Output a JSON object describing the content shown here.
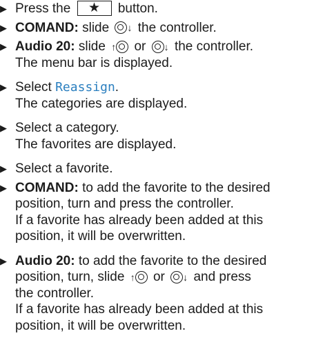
{
  "steps": [
    {
      "pre": "Press the",
      "key": "★",
      "post": "button."
    },
    {
      "label": "COMAND:",
      "text_a": "slide",
      "text_b": "the controller."
    },
    {
      "label": "Audio 20:",
      "text_a": "slide",
      "or": "or",
      "text_b": "the controller.",
      "result": "The menu bar is displayed."
    },
    {
      "pre": "Select",
      "menu_item": "Reassign",
      "post": ".",
      "result": "The categories are displayed."
    },
    {
      "text": "Select a category.",
      "result": "The favorites are displayed."
    },
    {
      "text": "Select a favorite."
    },
    {
      "label": "COMAND:",
      "text_line1": "to add the favorite to the desired",
      "text_line2": "position, turn and press the controller.",
      "result_line1": "If a favorite has already been added at this",
      "result_line2": "position, it will be overwritten."
    },
    {
      "label": "Audio 20:",
      "text_line1": "to add the favorite to the desired",
      "text_line2a": "position, turn, slide",
      "or": "or",
      "text_line2b": "and press",
      "text_line3": "the controller.",
      "result_line1": "If a favorite has already been added at this",
      "result_line2": "position, it will be overwritten."
    }
  ],
  "icons": {
    "bullet": "triangle-bullet-icon",
    "controller_down": "controller-slide-down-icon",
    "controller_up": "controller-slide-up-icon"
  }
}
